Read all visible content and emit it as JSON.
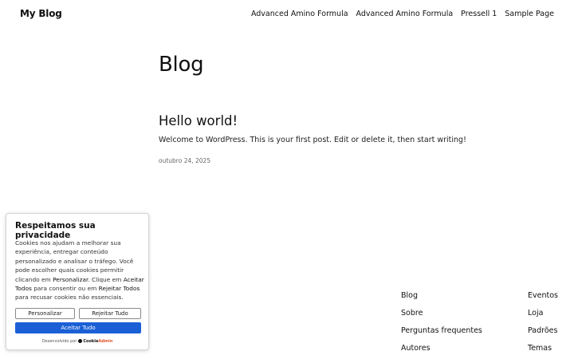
{
  "site": {
    "title": "My Blog"
  },
  "nav": [
    "Advanced Amino Formula",
    "Advanced Amino Formula",
    "Pressell 1",
    "Sample Page"
  ],
  "page": {
    "heading": "Blog"
  },
  "post": {
    "title": "Hello world!",
    "excerpt": "Welcome to WordPress. This is your first post. Edit or delete it, then start writing!",
    "date": "outubro 24, 2025"
  },
  "footer": {
    "col1": [
      "Blog",
      "Sobre",
      "Perguntas frequentes",
      "Autores"
    ],
    "col2": [
      "Eventos",
      "Loja",
      "Padrões",
      "Temas"
    ]
  },
  "cookie": {
    "title": "Respeitamos sua privacidade",
    "text_1": "Cookies nos ajudam a melhorar sua experiência, entregar conteúdo personalizado e analisar o tráfego. Você pode escolher quais cookies permitir clicando em ",
    "bold_1": "Personalizar",
    "text_2": ". Clique em ",
    "bold_2": "Aceitar Todos",
    "text_3": " para consentir ou em ",
    "bold_3": "Rejeitar Todos",
    "text_4": " para recusar cookies não essenciais.",
    "btn_customize": "Personalizar",
    "btn_reject": "Rejeitar Tudo",
    "btn_accept": "Aceitar Tudo",
    "powered_by": "Desenvolvido por",
    "brand_a": "Cookie",
    "brand_b": "Admin",
    "accent_color": "#1a5fd6"
  }
}
